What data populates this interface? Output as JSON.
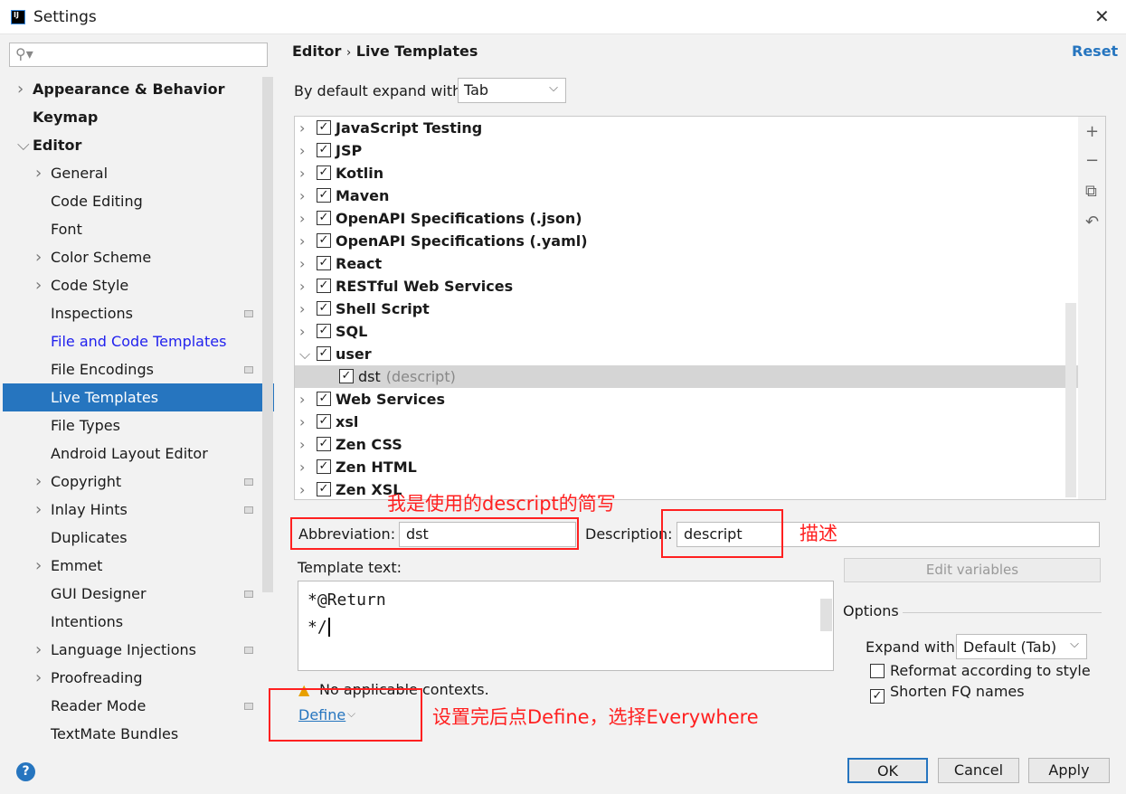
{
  "window": {
    "title": "Settings"
  },
  "sidebar": {
    "items": [
      {
        "label": "Appearance & Behavior",
        "level": 0,
        "expandable": true,
        "bold": true
      },
      {
        "label": "Keymap",
        "level": 0,
        "bold": true
      },
      {
        "label": "Editor",
        "level": 0,
        "expanded": true,
        "bold": true
      },
      {
        "label": "General",
        "level": 1,
        "expandable": true
      },
      {
        "label": "Code Editing",
        "level": 1
      },
      {
        "label": "Font",
        "level": 1
      },
      {
        "label": "Color Scheme",
        "level": 1,
        "expandable": true
      },
      {
        "label": "Code Style",
        "level": 1,
        "expandable": true
      },
      {
        "label": "Inspections",
        "level": 1,
        "config": true
      },
      {
        "label": "File and Code Templates",
        "level": 1,
        "link": true
      },
      {
        "label": "File Encodings",
        "level": 1,
        "config": true
      },
      {
        "label": "Live Templates",
        "level": 1,
        "selected": true
      },
      {
        "label": "File Types",
        "level": 1
      },
      {
        "label": "Android Layout Editor",
        "level": 1
      },
      {
        "label": "Copyright",
        "level": 1,
        "expandable": true,
        "config": true
      },
      {
        "label": "Inlay Hints",
        "level": 1,
        "expandable": true,
        "config": true
      },
      {
        "label": "Duplicates",
        "level": 1
      },
      {
        "label": "Emmet",
        "level": 1,
        "expandable": true
      },
      {
        "label": "GUI Designer",
        "level": 1,
        "config": true
      },
      {
        "label": "Intentions",
        "level": 1
      },
      {
        "label": "Language Injections",
        "level": 1,
        "expandable": true,
        "config": true
      },
      {
        "label": "Proofreading",
        "level": 1,
        "expandable": true
      },
      {
        "label": "Reader Mode",
        "level": 1,
        "config": true
      },
      {
        "label": "TextMate Bundles",
        "level": 1
      }
    ]
  },
  "header": {
    "crumb_parent": "Editor",
    "crumb_sep": "›",
    "crumb_current": "Live Templates",
    "reset": "Reset"
  },
  "expand": {
    "label": "By default expand with",
    "value": "Tab"
  },
  "tree": [
    {
      "label": "JavaScript Testing",
      "checked": true
    },
    {
      "label": "JSP",
      "checked": true
    },
    {
      "label": "Kotlin",
      "checked": true
    },
    {
      "label": "Maven",
      "checked": true
    },
    {
      "label": "OpenAPI Specifications (.json)",
      "checked": true
    },
    {
      "label": "OpenAPI Specifications (.yaml)",
      "checked": true
    },
    {
      "label": "React",
      "checked": true
    },
    {
      "label": "RESTful Web Services",
      "checked": true
    },
    {
      "label": "Shell Script",
      "checked": true
    },
    {
      "label": "SQL",
      "checked": true
    },
    {
      "label": "user",
      "checked": true,
      "expanded": true
    },
    {
      "label": "dst",
      "desc": "(descript)",
      "checked": true,
      "child": true,
      "selected": true
    },
    {
      "label": "Web Services",
      "checked": true
    },
    {
      "label": "xsl",
      "checked": true
    },
    {
      "label": "Zen CSS",
      "checked": true
    },
    {
      "label": "Zen HTML",
      "checked": true
    },
    {
      "label": "Zen XSL",
      "checked": true
    }
  ],
  "toolbar": {
    "add": "+",
    "remove": "−",
    "copy": "⧉",
    "revert": "↶"
  },
  "form": {
    "abbr_label": "Abbreviation:",
    "abbr_value": "dst",
    "desc_label": "Description:",
    "desc_value": "descript",
    "template_label": "Template text:",
    "template_lines": [
      "*@Return",
      "*/"
    ],
    "edit_variables": "Edit variables",
    "warning": "No applicable contexts.",
    "define": "Define"
  },
  "options": {
    "title": "Options",
    "expand_label": "Expand with",
    "expand_value": "Default (Tab)",
    "reformat": {
      "label": "Reformat according to style",
      "checked": false
    },
    "shorten": {
      "label": "Shorten FQ names",
      "checked": true
    }
  },
  "annotations": {
    "abbr_note": "我是使用的descript的简写",
    "desc_note": "描述",
    "define_note": "设置完后点Define，选择Everywhere"
  },
  "buttons": {
    "ok": "OK",
    "cancel": "Cancel",
    "apply": "Apply",
    "help": "?"
  },
  "colors": {
    "accent": "#2675bf",
    "annotation": "#ff2020"
  }
}
